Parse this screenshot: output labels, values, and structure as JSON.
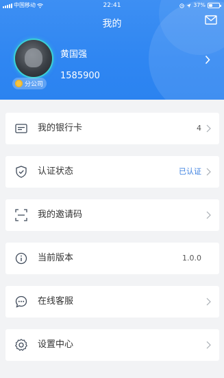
{
  "status_bar": {
    "carrier": "中国移动",
    "time": "22:41",
    "battery_pct": "37%",
    "battery_level": 0.37
  },
  "header": {
    "title": "我的",
    "user_name": "黄国强",
    "phone": "1585900",
    "badge_label": "分公司"
  },
  "menu": [
    {
      "label": "我的银行卡",
      "value": "4",
      "icon": "bank-card-icon"
    },
    {
      "label": "认证状态",
      "value": "已认证",
      "icon": "shield-check-icon"
    },
    {
      "label": "我的邀请码",
      "value": "",
      "icon": "scan-code-icon"
    },
    {
      "label": "当前版本",
      "value": "1.0.0",
      "icon": "info-icon"
    },
    {
      "label": "在线客服",
      "value": "",
      "icon": "chat-icon"
    },
    {
      "label": "设置中心",
      "value": "",
      "icon": "gear-icon"
    }
  ],
  "colors": {
    "header_blue": "#2f86f2",
    "verified_blue": "#3a7fe0",
    "page_bg": "#f2f3f5"
  }
}
